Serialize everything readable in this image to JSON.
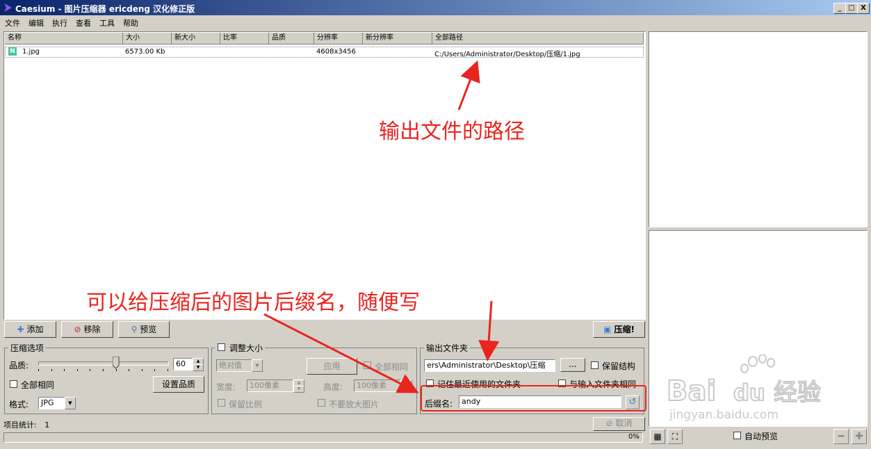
{
  "title": "Caesium - 图片压缩器  ericdeng 汉化修正版",
  "title_buttons": [
    "_",
    "□",
    "X"
  ],
  "menu": [
    "文件",
    "编辑",
    "执行",
    "查看",
    "工具",
    "帮助"
  ],
  "columns": [
    "名称",
    "大小",
    "新大小",
    "比率",
    "品质",
    "分辨率",
    "新分辨率",
    "全部路径"
  ],
  "rows": [
    {
      "icon": "N",
      "name": "1.jpg",
      "size": "6573.00 Kb",
      "new_size": "",
      "ratio": "",
      "quality": "",
      "resolution": "4608x3456",
      "new_resolution": "",
      "path": "C:/Users/Administrator/Desktop/压缩/1.jpg"
    }
  ],
  "toolbar": {
    "add": "添加",
    "remove": "移除",
    "preview": "预览",
    "compress": "压缩!"
  },
  "compress_options": {
    "group_title": "压缩选项",
    "quality_label": "品质:",
    "quality_value": 60,
    "quality_max": 100,
    "all_same": "全部相同",
    "set_quality": "设置品质",
    "format_label": "格式:",
    "format_value": "JPG"
  },
  "resize": {
    "group_title": "调整大小",
    "mode": "绝对值",
    "apply": "应用",
    "all_same": "全部相同",
    "width_label": "宽度:",
    "width_value": "100像素",
    "height_label": "高度:",
    "height_value": "100像素",
    "keep_ratio": "保留比例",
    "no_enlarge": "不要放大图片"
  },
  "output": {
    "group_title": "输出文件夹",
    "path": "ers\\Administrator\\Desktop\\压缩",
    "browse": "...",
    "keep_structure": "保留结构",
    "remember_last": "记住最近使用的文件夹",
    "same_as_input": "与输入文件夹相同",
    "suffix_label": "后缀名:",
    "suffix_value": "andy"
  },
  "status": {
    "items_label": "项目统计:",
    "items_count": "1",
    "cancel": "取消",
    "percent": "0%"
  },
  "preview_panel": {
    "auto_preview": "自动预览"
  },
  "annotations": {
    "path_note": "输出文件的路径",
    "suffix_note": "可以给压缩后的图片后缀名，随便写"
  },
  "watermark": {
    "logo": "Bai du 经验",
    "url": "jingyan.baidu.com"
  },
  "colors": {
    "title_start": "#0a246a",
    "title_end": "#a6caf0",
    "face": "#d4d0c8",
    "annotation": "#e8251f"
  }
}
